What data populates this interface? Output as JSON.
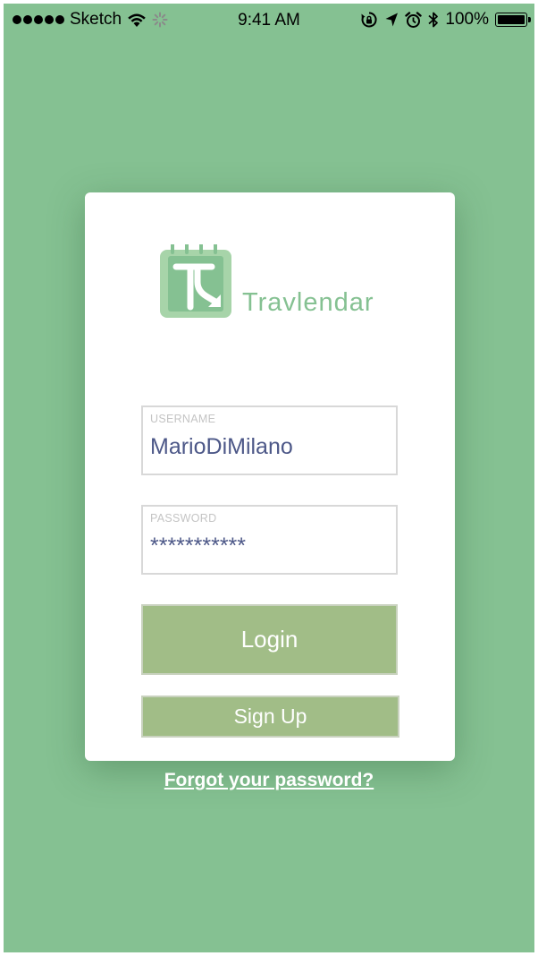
{
  "status_bar": {
    "carrier": "Sketch",
    "time": "9:41 AM",
    "battery_text": "100%",
    "icons": [
      "signal-dots-icon",
      "wifi-icon",
      "activity-spinner-icon",
      "rotation-lock-icon",
      "location-arrow-icon",
      "alarm-icon",
      "bluetooth-icon",
      "battery-icon"
    ]
  },
  "app": {
    "name": "Travlendar",
    "background_color": "#85c192",
    "button_color": "#a1bd87",
    "input_text_color": "#4d5888"
  },
  "login_form": {
    "username": {
      "label": "USERNAME",
      "value": "MarioDiMilano"
    },
    "password": {
      "label": "PASSWORD",
      "value": "***********"
    },
    "login_label": "Login",
    "signup_label": "Sign Up",
    "forgot_label": "Forgot your password?"
  }
}
